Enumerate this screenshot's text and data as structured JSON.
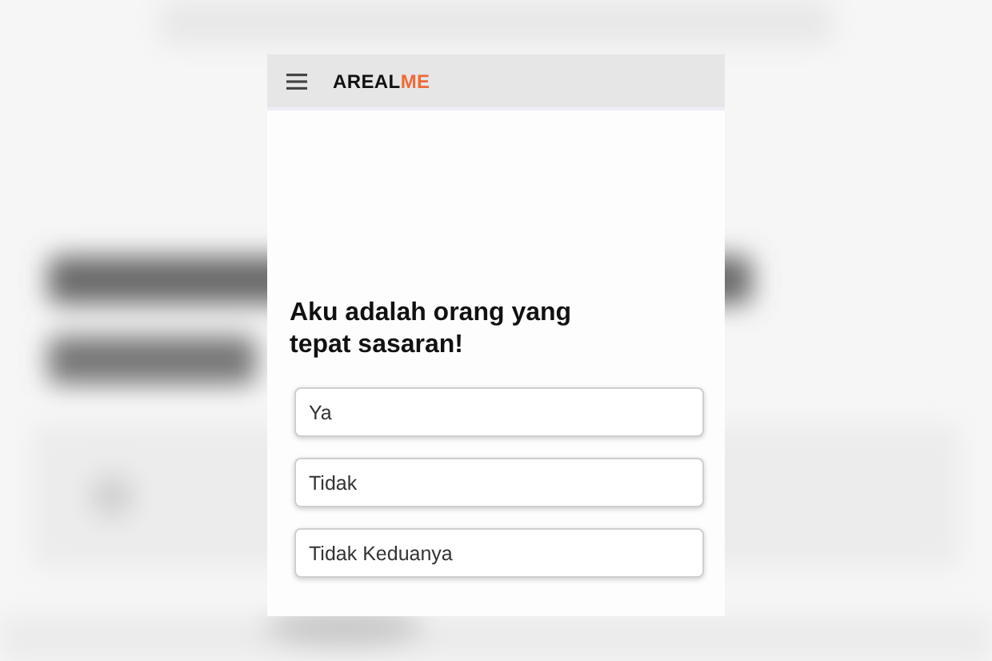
{
  "app_bar": {
    "brand": "AREAL",
    "brand_accent": "ME"
  },
  "question": "Aku adalah orang yang tepat sasaran!",
  "options": [
    {
      "label": "Ya"
    },
    {
      "label": "Tidak"
    },
    {
      "label": "Tidak Keduanya"
    }
  ]
}
